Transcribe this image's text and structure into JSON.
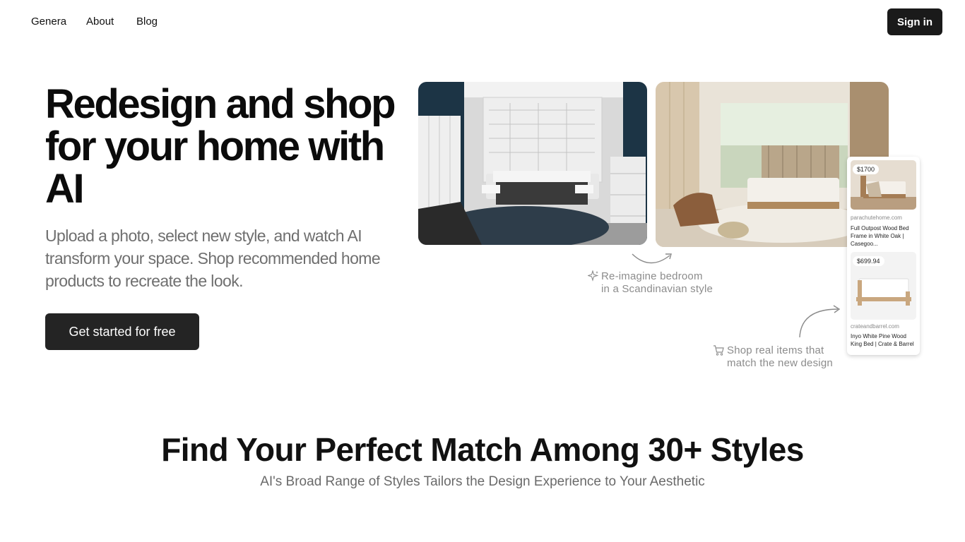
{
  "nav": {
    "links": [
      "Genera",
      "About",
      "Blog"
    ],
    "signin_label": "Sign in"
  },
  "hero": {
    "title": "Redesign and shop for your home with AI",
    "subtitle": "Upload a photo, select new style, and watch AI transform your space. Shop recommended home products to recreate the look.",
    "cta_label": "Get started for free"
  },
  "annotations": {
    "reimagine_line1": "Re-imagine bedroom",
    "reimagine_line2": "in a Scandinavian style",
    "reimagine_icon": "sparkle-icon",
    "shop_line1": "Shop real items that",
    "shop_line2": "match the new design",
    "shop_icon": "cart-icon"
  },
  "products": [
    {
      "price": "$1700",
      "domain": "parachutehome.com",
      "title": "Full Outpost Wood Bed Frame in White Oak | Casegoo..."
    },
    {
      "price": "$699.94",
      "domain": "crateandbarrel.com",
      "title": "Inyo White Pine Wood King Bed | Crate & Barrel"
    }
  ],
  "section": {
    "title": "Find Your Perfect Match Among 30+ Styles",
    "subtitle": "AI's Broad Range of Styles Tailors the Design Experience to Your Aesthetic"
  },
  "colors": {
    "button_dark": "#1a1a1a",
    "muted_text": "#8c8c8c"
  }
}
